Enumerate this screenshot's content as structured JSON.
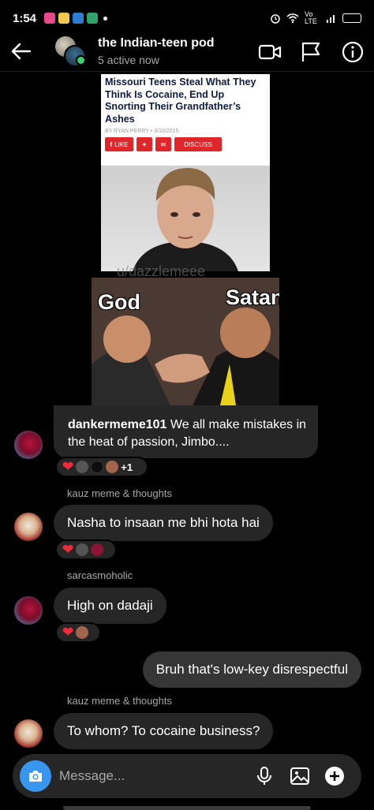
{
  "status_bar": {
    "time": "1:54",
    "network": "Vo LTE"
  },
  "header": {
    "title": "the Indian-teen pod",
    "subtitle": "5 active now",
    "icons": [
      "back-arrow-icon",
      "video-call-icon",
      "flag-icon",
      "info-icon"
    ]
  },
  "shared_post": {
    "article": {
      "headline": "Missouri Teens Steal What They Think Is Cocaine, End Up Snorting Their Grandfather’s Ashes",
      "byline": "BY RYAN PERRY • 3/10/2015",
      "share_like": "LIKE",
      "share_discuss": "DISCUSS"
    },
    "watermark": "u/dazzlemeee",
    "meme_left": "God",
    "meme_right": "Satan",
    "caption_user": "dankermeme101",
    "caption_text": "We all make mistakes in the heat of passion, Jimbo....",
    "reaction_extra": "+1"
  },
  "messages": [
    {
      "sender": "kauz meme & thoughts",
      "text": "Nasha to insaan me bhi hota hai"
    },
    {
      "sender": "sarcasmoholic",
      "text": "High on dadaji"
    },
    {
      "sender": "",
      "text": "Bruh that's low-key disrespectful"
    },
    {
      "sender": "kauz meme & thoughts",
      "text": "To whom? To cocaine business?"
    }
  ],
  "composer": {
    "placeholder": "Message...",
    "icons": [
      "camera-icon",
      "microphone-icon",
      "gallery-icon",
      "plus-icon"
    ]
  },
  "colors": {
    "accent": "#3797f0",
    "bubble_in": "#262626",
    "bubble_out": "#363636",
    "heart": "#ed2b3a",
    "online": "#3cd070"
  }
}
